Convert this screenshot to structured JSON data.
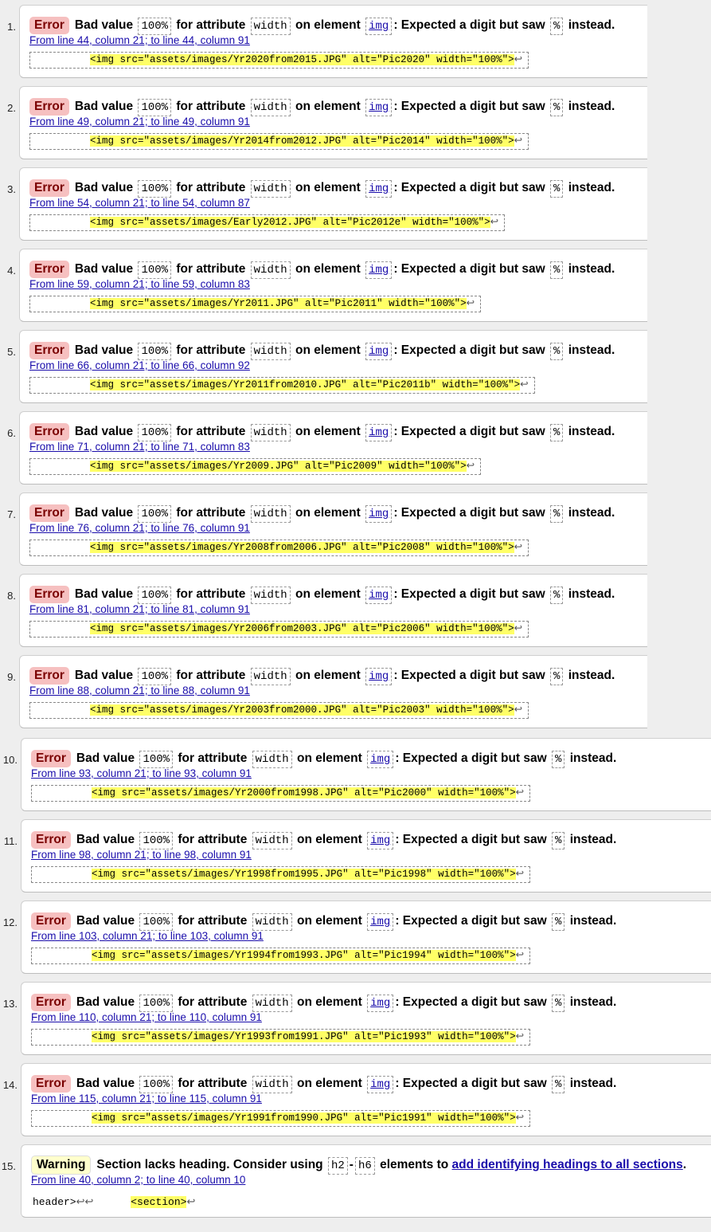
{
  "messages": [
    {
      "num": "1.",
      "type": "Error",
      "p1": "Bad value",
      "v": "100%",
      "p2": "for attribute",
      "a": "width",
      "p3": "on element",
      "e": "img",
      "p4": ": Expected a digit but saw",
      "c": "%",
      "p5": "instead.",
      "loc": "From line 44, column 21; to line 44, column 91",
      "ext": "<img src=\"assets/images/Yr2020from2015.JPG\" alt=\"Pic2020\" width=\"100%\">"
    },
    {
      "num": "2.",
      "type": "Error",
      "p1": "Bad value",
      "v": "100%",
      "p2": "for attribute",
      "a": "width",
      "p3": "on element",
      "e": "img",
      "p4": ": Expected a digit but saw",
      "c": "%",
      "p5": "instead.",
      "loc": "From line 49, column 21; to line 49, column 91",
      "ext": "<img src=\"assets/images/Yr2014from2012.JPG\" alt=\"Pic2014\" width=\"100%\">"
    },
    {
      "num": "3.",
      "type": "Error",
      "p1": "Bad value",
      "v": "100%",
      "p2": "for attribute",
      "a": "width",
      "p3": "on element",
      "e": "img",
      "p4": ": Expected a digit but saw",
      "c": "%",
      "p5": "instead.",
      "loc": "From line 54, column 21; to line 54, column 87",
      "ext": "<img src=\"assets/images/Early2012.JPG\" alt=\"Pic2012e\" width=\"100%\">"
    },
    {
      "num": "4.",
      "type": "Error",
      "p1": "Bad value",
      "v": "100%",
      "p2": "for attribute",
      "a": "width",
      "p3": "on element",
      "e": "img",
      "p4": ": Expected a digit but saw",
      "c": "%",
      "p5": "instead.",
      "loc": "From line 59, column 21; to line 59, column 83",
      "ext": "<img src=\"assets/images/Yr2011.JPG\" alt=\"Pic2011\" width=\"100%\">"
    },
    {
      "num": "5.",
      "type": "Error",
      "p1": "Bad value",
      "v": "100%",
      "p2": "for attribute",
      "a": "width",
      "p3": "on element",
      "e": "img",
      "p4": ": Expected a digit but saw",
      "c": "%",
      "p5": "instead.",
      "loc": "From line 66, column 21; to line 66, column 92",
      "ext": "<img src=\"assets/images/Yr2011from2010.JPG\" alt=\"Pic2011b\" width=\"100%\">"
    },
    {
      "num": "6.",
      "type": "Error",
      "p1": "Bad value",
      "v": "100%",
      "p2": "for attribute",
      "a": "width",
      "p3": "on element",
      "e": "img",
      "p4": ": Expected a digit but saw",
      "c": "%",
      "p5": "instead.",
      "loc": "From line 71, column 21; to line 71, column 83",
      "ext": "<img src=\"assets/images/Yr2009.JPG\" alt=\"Pic2009\" width=\"100%\">"
    },
    {
      "num": "7.",
      "type": "Error",
      "p1": "Bad value",
      "v": "100%",
      "p2": "for attribute",
      "a": "width",
      "p3": "on element",
      "e": "img",
      "p4": ": Expected a digit but saw",
      "c": "%",
      "p5": "instead.",
      "loc": "From line 76, column 21; to line 76, column 91",
      "ext": "<img src=\"assets/images/Yr2008from2006.JPG\" alt=\"Pic2008\" width=\"100%\">"
    },
    {
      "num": "8.",
      "type": "Error",
      "p1": "Bad value",
      "v": "100%",
      "p2": "for attribute",
      "a": "width",
      "p3": "on element",
      "e": "img",
      "p4": ": Expected a digit but saw",
      "c": "%",
      "p5": "instead.",
      "loc": "From line 81, column 21; to line 81, column 91",
      "ext": "<img src=\"assets/images/Yr2006from2003.JPG\" alt=\"Pic2006\" width=\"100%\">"
    },
    {
      "num": "9.",
      "type": "Error",
      "p1": "Bad value",
      "v": "100%",
      "p2": "for attribute",
      "a": "width",
      "p3": "on element",
      "e": "img",
      "p4": ": Expected a digit but saw",
      "c": "%",
      "p5": "instead.",
      "loc": "From line 88, column 21; to line 88, column 91",
      "ext": "<img src=\"assets/images/Yr2003from2000.JPG\" alt=\"Pic2003\" width=\"100%\">"
    },
    {
      "num": "10.",
      "type": "Error",
      "p1": "Bad value",
      "v": "100%",
      "p2": "for attribute",
      "a": "width",
      "p3": "on element",
      "e": "img",
      "p4": ": Expected a digit but saw",
      "c": "%",
      "p5": "instead.",
      "loc": "From line 93, column 21; to line 93, column 91",
      "ext": "<img src=\"assets/images/Yr2000from1998.JPG\" alt=\"Pic2000\" width=\"100%\">"
    },
    {
      "num": "11.",
      "type": "Error",
      "p1": "Bad value",
      "v": "100%",
      "p2": "for attribute",
      "a": "width",
      "p3": "on element",
      "e": "img",
      "p4": ": Expected a digit but saw",
      "c": "%",
      "p5": "instead.",
      "loc": "From line 98, column 21; to line 98, column 91",
      "ext": "<img src=\"assets/images/Yr1998from1995.JPG\" alt=\"Pic1998\" width=\"100%\">"
    },
    {
      "num": "12.",
      "type": "Error",
      "p1": "Bad value",
      "v": "100%",
      "p2": "for attribute",
      "a": "width",
      "p3": "on element",
      "e": "img",
      "p4": ": Expected a digit but saw",
      "c": "%",
      "p5": "instead.",
      "loc": "From line 103, column 21; to line 103, column 91",
      "ext": "<img src=\"assets/images/Yr1994from1993.JPG\" alt=\"Pic1994\" width=\"100%\">"
    },
    {
      "num": "13.",
      "type": "Error",
      "p1": "Bad value",
      "v": "100%",
      "p2": "for attribute",
      "a": "width",
      "p3": "on element",
      "e": "img",
      "p4": ": Expected a digit but saw",
      "c": "%",
      "p5": "instead.",
      "loc": "From line 110, column 21; to line 110, column 91",
      "ext": "<img src=\"assets/images/Yr1993from1991.JPG\" alt=\"Pic1993\" width=\"100%\">"
    },
    {
      "num": "14.",
      "type": "Error",
      "p1": "Bad value",
      "v": "100%",
      "p2": "for attribute",
      "a": "width",
      "p3": "on element",
      "e": "img",
      "p4": ": Expected a digit but saw",
      "c": "%",
      "p5": "instead.",
      "loc": "From line 115, column 21; to line 115, column 91",
      "ext": "<img src=\"assets/images/Yr1991from1990.JPG\" alt=\"Pic1991\" width=\"100%\">"
    }
  ],
  "warning": {
    "num": "15.",
    "type": "Warning",
    "p1": "Section lacks heading. Consider using",
    "c1": "h2",
    "dash": "-",
    "c2": "h6",
    "p2": "elements to",
    "link": "add identifying headings to all sections",
    "p3": ".",
    "loc": "From line 40, column 2; to line 40, column 10",
    "pre": "header>",
    "code": "<section>"
  },
  "glyphs": {
    "newline": "↩"
  },
  "colors": {
    "error_badge": "#f6c0c0",
    "warning_badge": "#ffffcc",
    "highlight": "#ffff66",
    "link": "#1a0dab"
  }
}
